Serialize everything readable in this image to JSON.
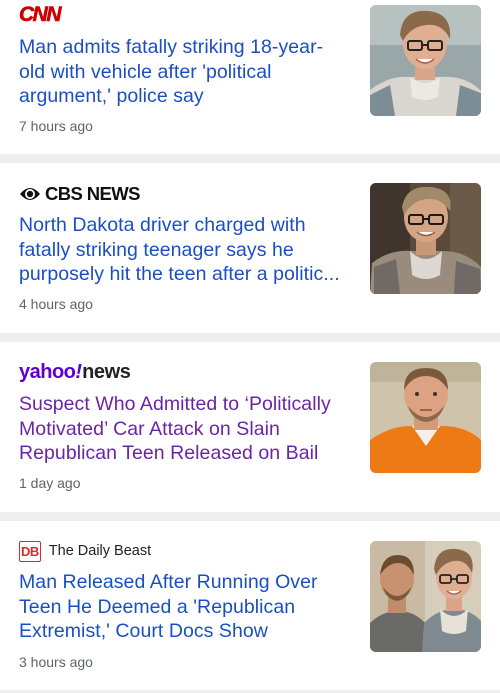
{
  "articles": [
    {
      "source": "CNN",
      "headline": "Man admits fatally striking 18-year-old with vehicle after 'political argument,' police say",
      "time": "7 hours ago",
      "thumbnail_icon": "portrait-teen-glasses"
    },
    {
      "source": "CBS NEWS",
      "headline": "North Dakota driver charged with fatally striking teenager says he purposely hit the teen after a politic...",
      "time": "4 hours ago",
      "thumbnail_icon": "portrait-teen-glasses"
    },
    {
      "source_main": "yahoo",
      "source_mark": "!",
      "source_sub": "news",
      "headline": "Suspect Who Admitted to ‘Politically Motivated’ Car Attack on Slain Republican Teen Released on Bail",
      "time": "1 day ago",
      "thumbnail_icon": "portrait-suspect-orange"
    },
    {
      "source_logo": "DB",
      "source": "The Daily Beast",
      "headline": "Man Released After Running Over Teen He Deemed a 'Republican Extremist,' Court Docs Show",
      "time": "3 hours ago",
      "thumbnail_icon": "composite-portraits"
    }
  ],
  "colors": {
    "headline": "#1a4fc4",
    "headline_visited": "#6a25a6",
    "cnn_red": "#cc0000",
    "yahoo_purple": "#6001d2",
    "daily_beast_red": "#e3262c",
    "divider": "#eeeeee",
    "time_gray": "#5f6368"
  }
}
